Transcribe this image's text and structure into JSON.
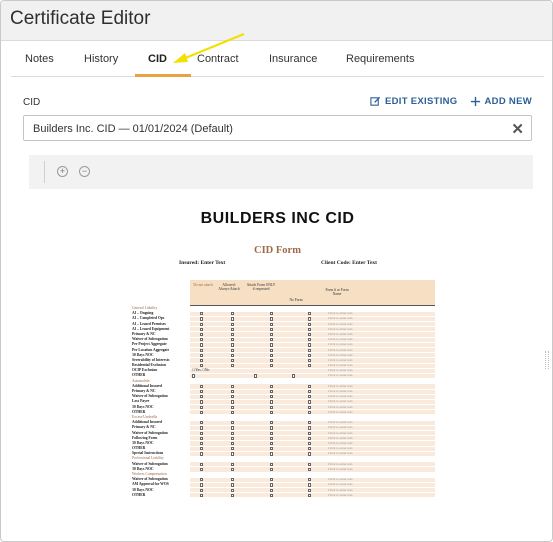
{
  "window": {
    "title": "Certificate Editor"
  },
  "tabs": [
    {
      "label": "Notes"
    },
    {
      "label": "History"
    },
    {
      "label": "CID"
    },
    {
      "label": "Contract"
    },
    {
      "label": "Insurance"
    },
    {
      "label": "Requirements"
    }
  ],
  "active_tab": "CID",
  "cid_section": {
    "label": "CID",
    "edit_existing": "EDIT EXISTING",
    "add_new": "ADD NEW",
    "selected_value": "Builders Inc. CID — 01/01/2024 (Default)",
    "clear_symbol": "✕"
  },
  "viewer": {
    "zoom_in": "+",
    "zoom_out": "−"
  },
  "document": {
    "heading": "BUILDERS INC CID",
    "form_title": "CID Form",
    "insured_label": "Insured: Enter Text",
    "client_code_label": "Client Code: Enter Text",
    "columns": [
      "Do not attach",
      "Allowed: Always Attach",
      "Attach Form ONLY if requested",
      "No Form",
      "Form # or Form Name"
    ],
    "placeholder": "Click to enter text.",
    "rows": [
      {
        "label": "General Liability",
        "section": true
      },
      {
        "label": "AI – Ongoing"
      },
      {
        "label": "AI – Completed Ops"
      },
      {
        "label": "AI – Leased Premises"
      },
      {
        "label": "AI – Leased Equipment"
      },
      {
        "label": "Primary & NC"
      },
      {
        "label": "Waiver of Subrogation"
      },
      {
        "label": "Per Project Aggregate"
      },
      {
        "label": "Per Location Aggregate"
      },
      {
        "label": "30 Days NOC"
      },
      {
        "label": "Severability of Interests"
      },
      {
        "label": "Residential Exclusion"
      },
      {
        "label": "OCIP Exclusion",
        "special": "☐Yes ☐No"
      },
      {
        "label": "OTHER",
        "other": true
      },
      {
        "label": "Automobile",
        "section": true
      },
      {
        "label": "Additional Insured"
      },
      {
        "label": "Primary & NC"
      },
      {
        "label": "Waiver of Subrogation"
      },
      {
        "label": "Loss Payee"
      },
      {
        "label": "30 Days NOC"
      },
      {
        "label": "OTHER"
      },
      {
        "label": "Excess/Umbrella",
        "section": true
      },
      {
        "label": "Additional Insured"
      },
      {
        "label": "Primary & NC"
      },
      {
        "label": "Waiver of Subrogation"
      },
      {
        "label": "Following Form"
      },
      {
        "label": "30 Days NOC"
      },
      {
        "label": "OTHER"
      },
      {
        "label": "Special Instructions"
      },
      {
        "label": "Professional Liability",
        "section": true
      },
      {
        "label": "Waiver of Subrogation"
      },
      {
        "label": "30 Days NOC"
      },
      {
        "label": "Workers Compensation",
        "section": true
      },
      {
        "label": "Waiver of Subrogation"
      },
      {
        "label": "AM Approval for WOS"
      },
      {
        "label": "30 Days NOC"
      },
      {
        "label": "OTHER"
      }
    ]
  },
  "colors": {
    "accent": "#e8a23f",
    "link": "#2d5f97",
    "arrow": "#f2e000",
    "table_band": "#f9eadb"
  }
}
